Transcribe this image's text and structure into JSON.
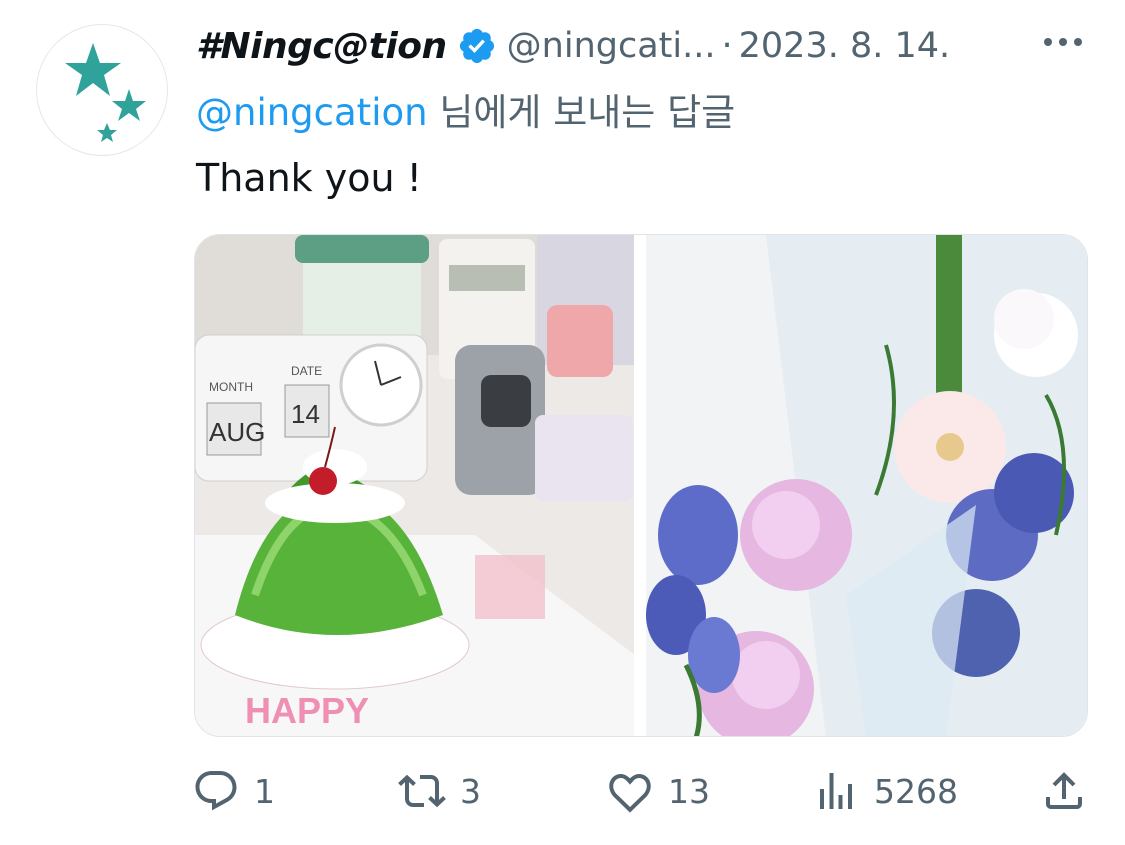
{
  "tweet": {
    "author_name": "#Ningc@tion",
    "handle": "@ningcati...",
    "separator": "·",
    "date": "2023. 8. 14.",
    "reply_mention": "@ningcation",
    "reply_suffix": " 님에게 보내는 답글",
    "text": "Thank you !"
  },
  "media": {
    "left_image": "photo of a green jelly birthday cake with cherry, pink HAPPY letters, flip calendar AUG 14, camcorder",
    "right_image": "photo of a flower bouquet with pink lisianthus, blue flowers and white gerbera"
  },
  "cake_text": {
    "month_label": "MONTH",
    "date_label": "DATE",
    "month": "AUG",
    "day": "14",
    "happy": "HAPPY"
  },
  "actions": {
    "replies": "1",
    "retweets": "3",
    "likes": "13",
    "views": "5268"
  },
  "colors": {
    "accent": "#1d9bf0",
    "secondary_text": "#536471",
    "verified": "#1d9bf0",
    "avatar_star": "#2fa39a"
  },
  "icons": [
    "verified-badge-icon",
    "more-icon",
    "reply-icon",
    "retweet-icon",
    "like-icon",
    "views-icon",
    "share-icon"
  ]
}
